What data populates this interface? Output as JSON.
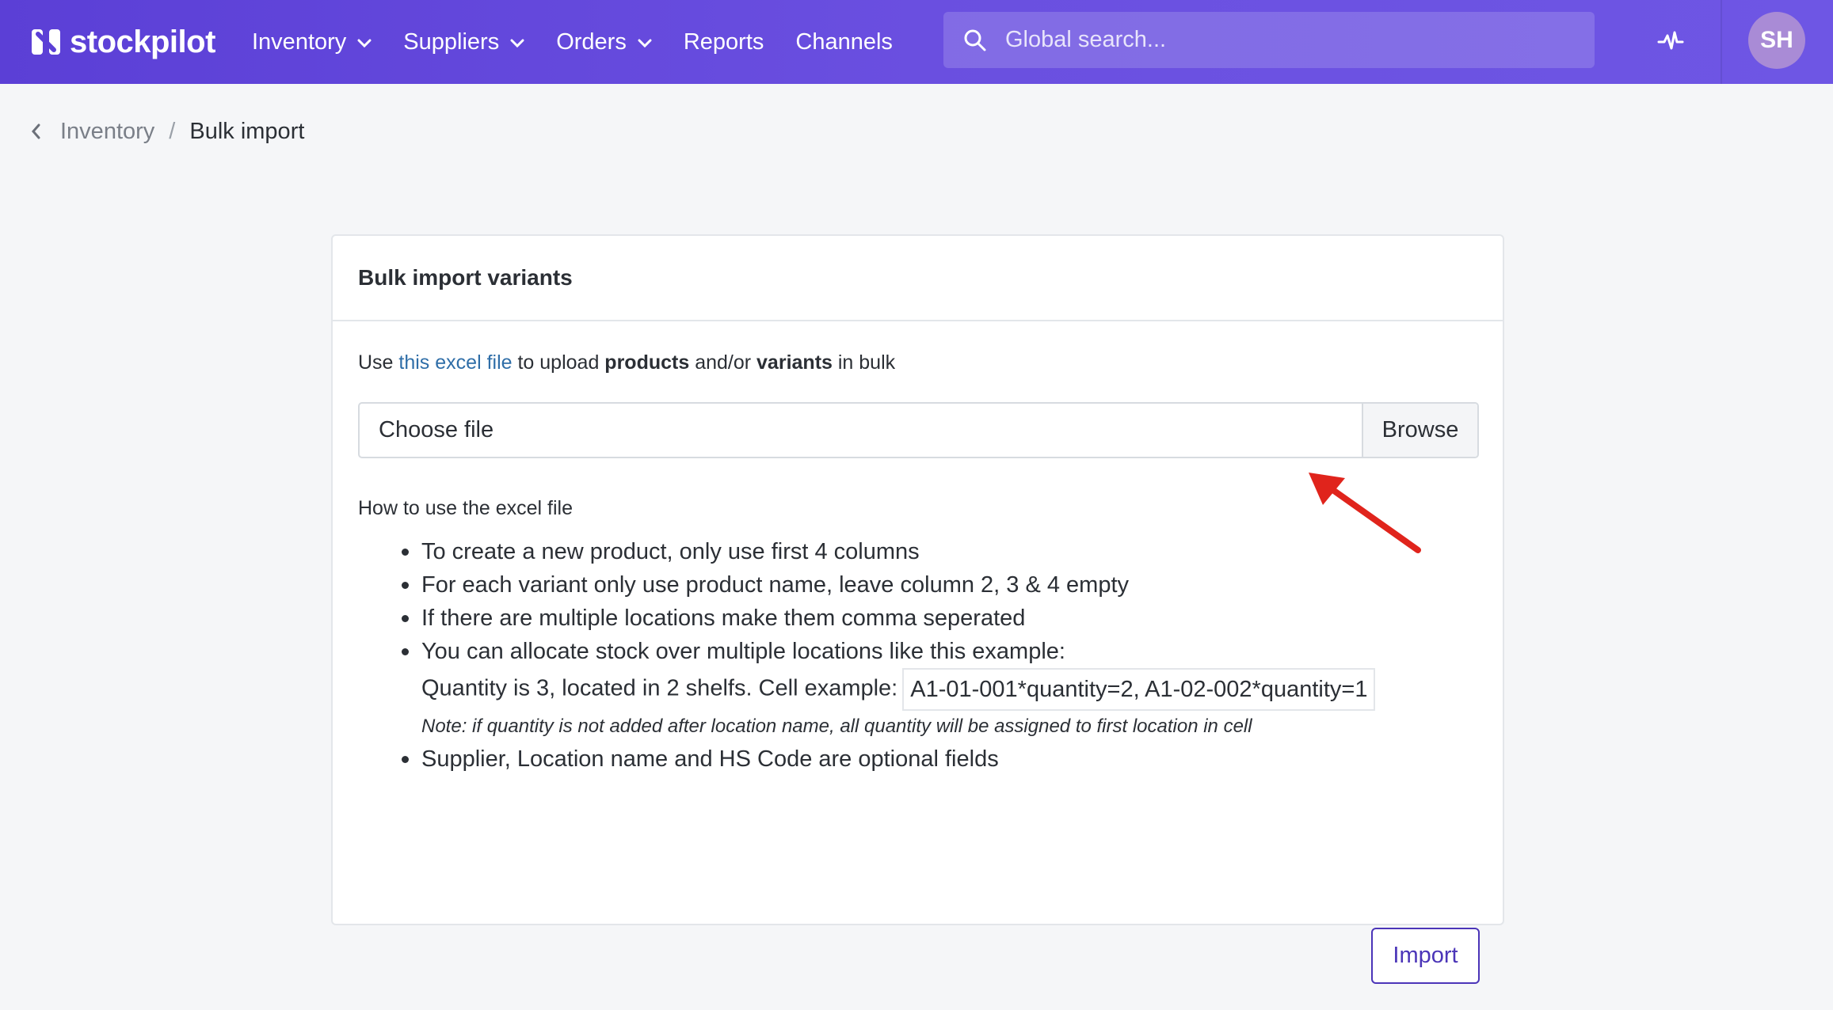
{
  "brand": {
    "name": "stockpilot"
  },
  "nav": {
    "items": [
      {
        "label": "Inventory",
        "has_dropdown": true
      },
      {
        "label": "Suppliers",
        "has_dropdown": true
      },
      {
        "label": "Orders",
        "has_dropdown": true
      },
      {
        "label": "Reports",
        "has_dropdown": false
      },
      {
        "label": "Channels",
        "has_dropdown": false
      }
    ]
  },
  "search": {
    "placeholder": "Global search..."
  },
  "user": {
    "initials": "SH"
  },
  "breadcrumb": {
    "parent": "Inventory",
    "separator": "/",
    "current": "Bulk import"
  },
  "card": {
    "title": "Bulk import variants",
    "intro": {
      "prefix": "Use ",
      "link": "this excel file",
      "middle1": " to upload ",
      "bold1": "products",
      "middle2": " and/or ",
      "bold2": "variants",
      "suffix": " in bulk"
    },
    "file_input": {
      "placeholder": "Choose file",
      "browse_label": "Browse"
    },
    "howto_title": "How to use the excel file",
    "instructions": [
      "To create a new product, only use first 4 columns",
      "For each variant only use product name, leave column 2, 3 & 4 empty",
      "If there are multiple locations make them comma seperated",
      "You can allocate stock over multiple locations like this example:"
    ],
    "example_line": "Quantity is 3, located in 2 shelfs. Cell example:",
    "example_code": "A1-01-001*quantity=2, A1-02-002*quantity=1",
    "note": "Note: if quantity is not added after location name, all quantity will be assigned to first location in cell",
    "last_instruction": "Supplier, Location name and HS Code are optional fields",
    "import_label": "Import"
  },
  "colors": {
    "nav_bg": "#5b3fd6",
    "accent": "#4b35b8",
    "link": "#2f6ea8",
    "annotation_arrow": "#e0241c"
  }
}
